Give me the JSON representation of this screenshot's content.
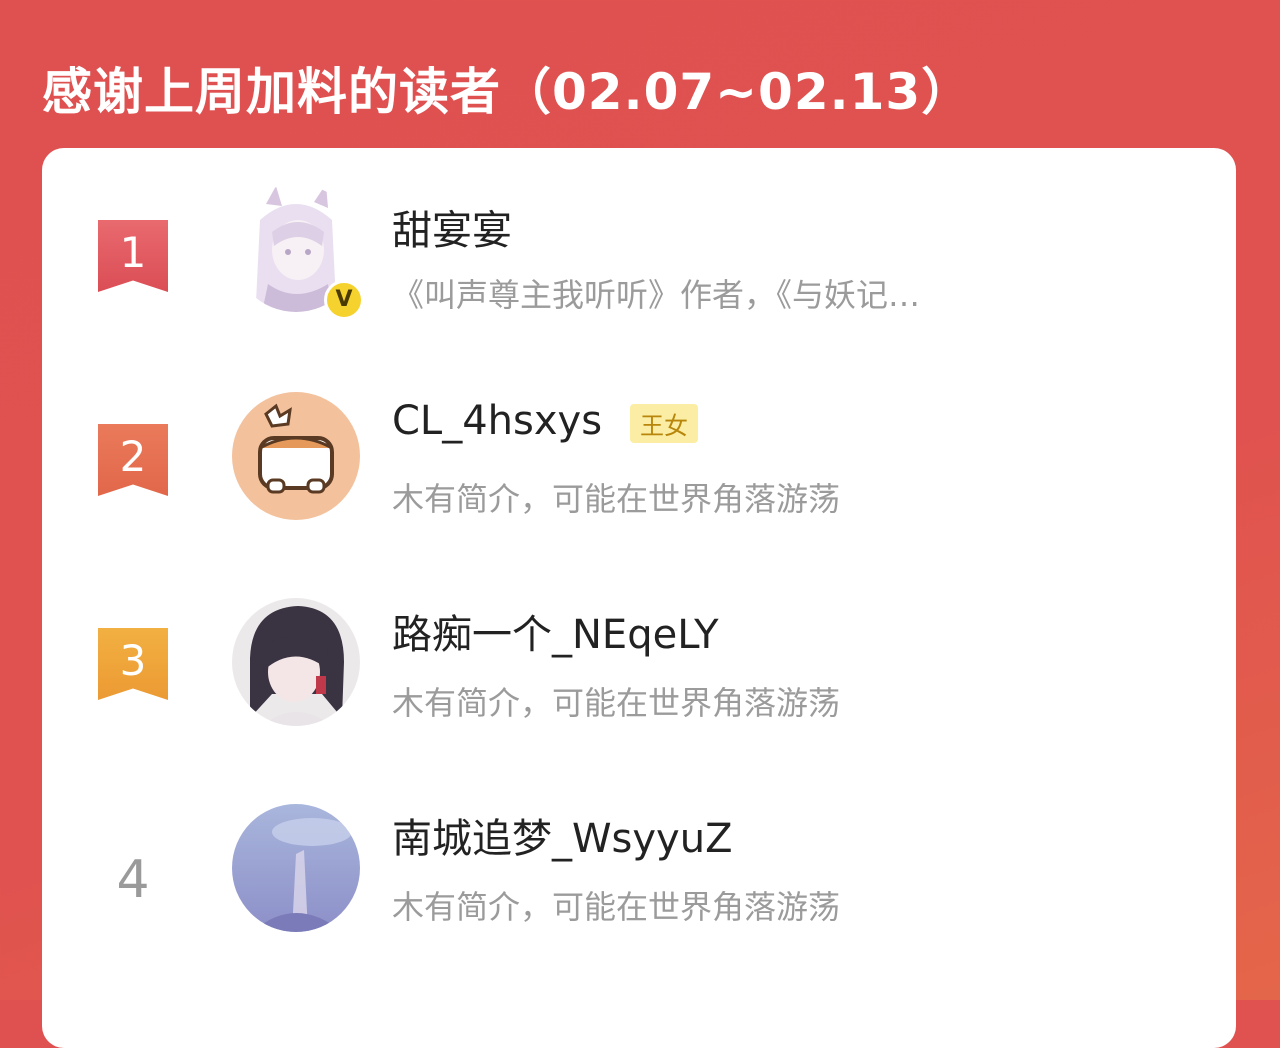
{
  "header": {
    "title": "感谢上周加料的读者（02.07~02.13）"
  },
  "colors": {
    "background": "#df5150",
    "rank1": "#e0555b",
    "rank2": "#e4704f",
    "rank3": "#efa03a",
    "tag_bg": "#fbeea4"
  },
  "readers": [
    {
      "rank": "1",
      "name": "甜宴宴",
      "desc": "《叫声尊主我听听》作者，《与妖记…",
      "badge": "V",
      "avatar_icon": "anime-girl-avatar-icon"
    },
    {
      "rank": "2",
      "name": "CL_4hsxys",
      "tag": "王女",
      "desc": "木有简介，可能在世界角落游荡",
      "avatar_icon": "cartoon-dog-avatar-icon"
    },
    {
      "rank": "3",
      "name": "路痴一个_NEqeLY",
      "desc": "木有简介，可能在世界角落游荡",
      "avatar_icon": "dark-hair-girl-avatar-icon"
    },
    {
      "rank": "4",
      "name": "南城追梦_WsyyuZ",
      "desc": "木有简介，可能在世界角落游荡",
      "avatar_icon": "sky-landscape-avatar-icon"
    }
  ]
}
